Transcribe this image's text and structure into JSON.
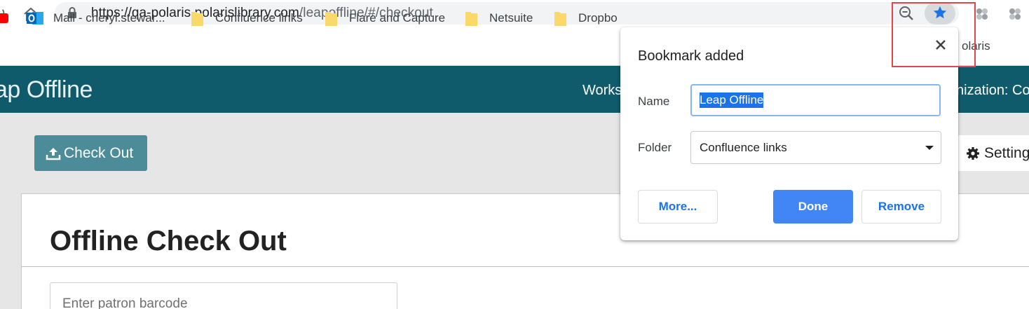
{
  "browser": {
    "url_host": "https://qa-polaris.polarislibrary.com",
    "url_path": "/leapoffline/#/checkout",
    "bookmarks": [
      {
        "label": "Mail - cheryl.stewar...",
        "icon": "outlook-icon"
      },
      {
        "label": "Confluence links",
        "icon": "folder-icon"
      },
      {
        "label": "Flare and Capture",
        "icon": "folder-icon"
      },
      {
        "label": "Netsuite",
        "icon": "folder-icon"
      },
      {
        "label": "Dropbo",
        "icon": "folder-icon"
      }
    ],
    "peek_label": "olaris"
  },
  "app": {
    "brand": "ap Offline",
    "nav_workstation": "Works",
    "nav_organization": "nization: Co",
    "checkout_label": "Check Out",
    "settings_label": "Setting",
    "page_title": "Offline Check Out",
    "barcode_placeholder": "Enter patron barcode"
  },
  "dialog": {
    "title": "Bookmark added",
    "name_label": "Name",
    "name_value": "Leap Offline",
    "folder_label": "Folder",
    "folder_value": "Confluence links",
    "more_label": "More...",
    "done_label": "Done",
    "remove_label": "Remove"
  },
  "colors": {
    "app_header": "#0f5a6b",
    "primary_button": "#4285f4",
    "checkout_button": "#4c8c99",
    "highlight": "#e0464e"
  }
}
